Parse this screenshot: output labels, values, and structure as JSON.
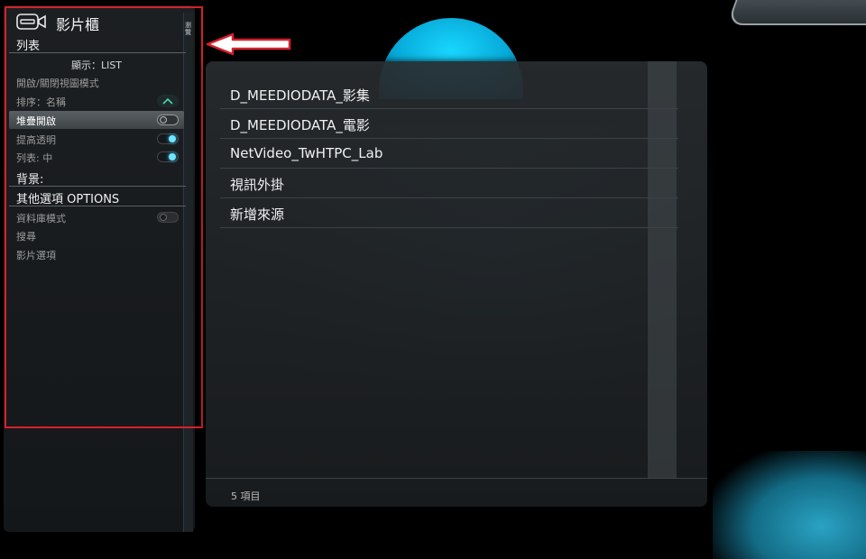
{
  "panel": {
    "title": "影片櫃",
    "side_tab_label": "瀏覽"
  },
  "menu": {
    "section_list": "列表",
    "view_mode": "顯示：LIST",
    "toggle_view_mode": "開啟/關閉視圖模式",
    "sort": "排序：名稱",
    "stacking": "堆疊開啟",
    "stacking_state": "off",
    "transparency": "提高透明",
    "transparency_state": "on",
    "list_size": "列表: 中",
    "list_size_state": "on",
    "section_background": "背景:",
    "section_other": "其他選項 OPTIONS",
    "library_mode": "資料庫模式",
    "library_mode_state": "off",
    "search": "搜尋",
    "video_options": "影片選項"
  },
  "sources": {
    "items": [
      "D_MEEDIODATA_影集",
      "D_MEEDIODATA_電影",
      "NetVideo_TwHTPC_Lab",
      "視訊外掛",
      "新增來源"
    ],
    "count_label": "5 項目"
  },
  "colors": {
    "accent": "#6fe4ff",
    "annotation": "#d6202a",
    "background": "#000000"
  }
}
